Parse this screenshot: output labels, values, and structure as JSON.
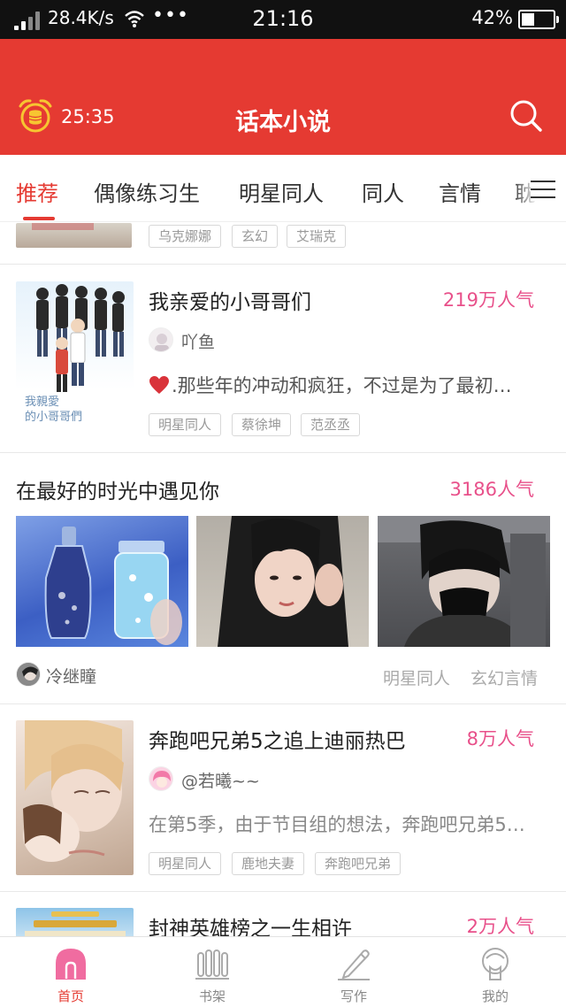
{
  "status_bar": {
    "speed": "28.4K/s",
    "dots": "•••",
    "time": "21:16",
    "battery": "42%",
    "battery_level": 0.42
  },
  "header": {
    "timer": "25:35",
    "title": "话本小说"
  },
  "tabs": [
    "推荐",
    "偶像练习生",
    "明星同人",
    "同人",
    "言情",
    "耽"
  ],
  "active_tab": "推荐",
  "feed": {
    "partial_item": {
      "tags": [
        "乌克娜娜",
        "玄幻",
        "艾瑞克"
      ]
    },
    "book1": {
      "title": "我亲爱的小哥哥们",
      "popularity": "219万人气",
      "author": "吖鱼",
      "summary": ".那些年的冲动和疯狂，不过是为了最初…",
      "tags": [
        "明星同人",
        "蔡徐坤",
        "范丞丞"
      ],
      "cover_text": "我親愛\n的小哥哥們"
    },
    "story2": {
      "title": "在最好的时光中遇见你",
      "popularity": "3186人气",
      "author": "冷继瞳",
      "tags": [
        "明星同人",
        "玄幻言情"
      ]
    },
    "book3": {
      "title": "奔跑吧兄弟5之追上迪丽热巴",
      "popularity": "8万人气",
      "author": "@若曦~~",
      "summary": "在第5季，由于节目组的想法，奔跑吧兄弟5…",
      "tags": [
        "明星同人",
        "鹿地夫妻",
        "奔跑吧兄弟"
      ]
    },
    "book4": {
      "title": "封神英雄榜之一生相许",
      "popularity": "2万人气"
    }
  },
  "bottom_nav": [
    {
      "label": "首页",
      "icon": "home-icon"
    },
    {
      "label": "书架",
      "icon": "bookshelf-icon"
    },
    {
      "label": "写作",
      "icon": "write-icon"
    },
    {
      "label": "我的",
      "icon": "profile-icon"
    }
  ],
  "colors": {
    "brand_red": "#e53a32",
    "popularity_pink": "#e8508a",
    "status_bar": "#111111"
  }
}
